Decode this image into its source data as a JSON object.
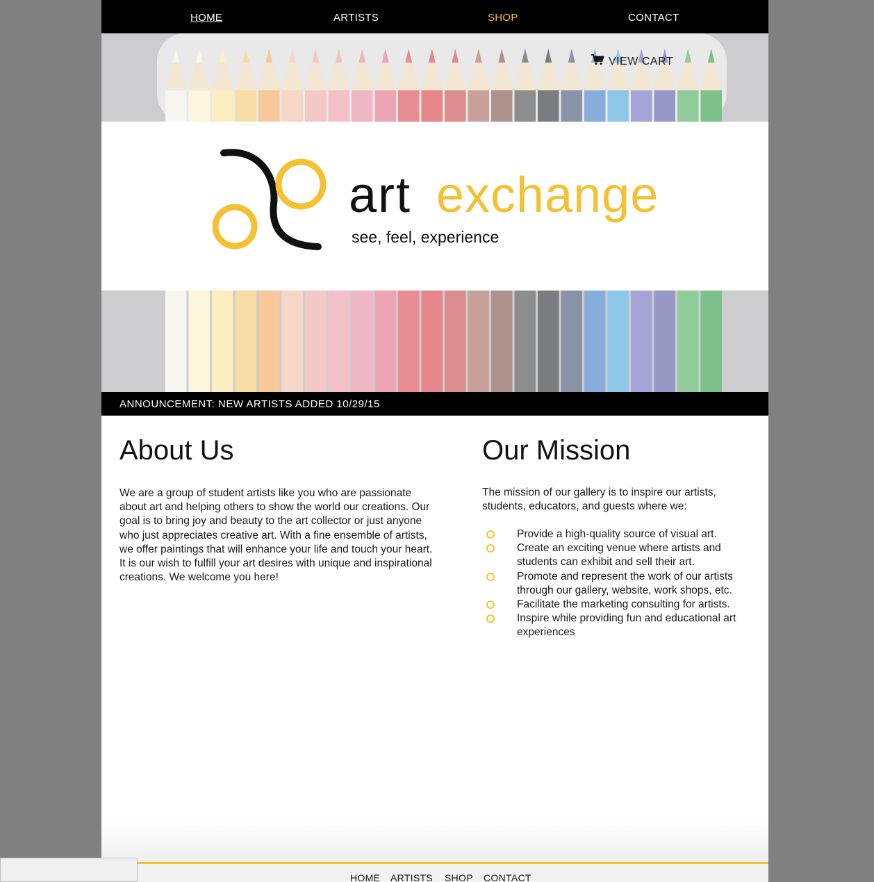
{
  "nav": {
    "home": "HOME",
    "artists": "ARTISTS",
    "shop": "SHOP",
    "contact": "CONTACT"
  },
  "cart": {
    "label": "VIEW CART",
    "icon": "shopping-cart-icon"
  },
  "logo": {
    "word_art": "art",
    "word_exchange": "exchange",
    "tagline": "see, feel, experience"
  },
  "announcement": "ANNOUNCEMENT: NEW ARTISTS ADDED 10/29/15",
  "about": {
    "title": "About Us",
    "body": "We are a group of student artists like you who are passionate about art and helping others to show the world our creations. Our goal is to bring joy and beauty to the art collector or just anyone who just appreciates creative art. With a fine ensemble of artists, we offer paintings that will enhance your life and touch your heart. It is our wish to fulfill your art desires with unique and inspirational creations. We welcome you here!"
  },
  "mission": {
    "title": "Our Mission",
    "intro": "The mission of our gallery is to inspire our artists, students, educators, and guests where we:",
    "items": [
      "Provide a high-quality source of visual art.",
      "Create an exciting venue where artists and students can exhibit and sell their art.",
      "Promote and represent the work of our artists through our gallery, website, work shops, etc.",
      "Facilitate the marketing consulting for artists.",
      "Inspire while providing fun and educational art experiences"
    ]
  },
  "footer": {
    "home": "HOME",
    "artists": "ARTISTS",
    "shop": "SHOP",
    "contact": "CONTACT"
  },
  "colors": {
    "accent": "#f4c134",
    "nav_bg": "#000000",
    "page_bg": "#808080"
  }
}
